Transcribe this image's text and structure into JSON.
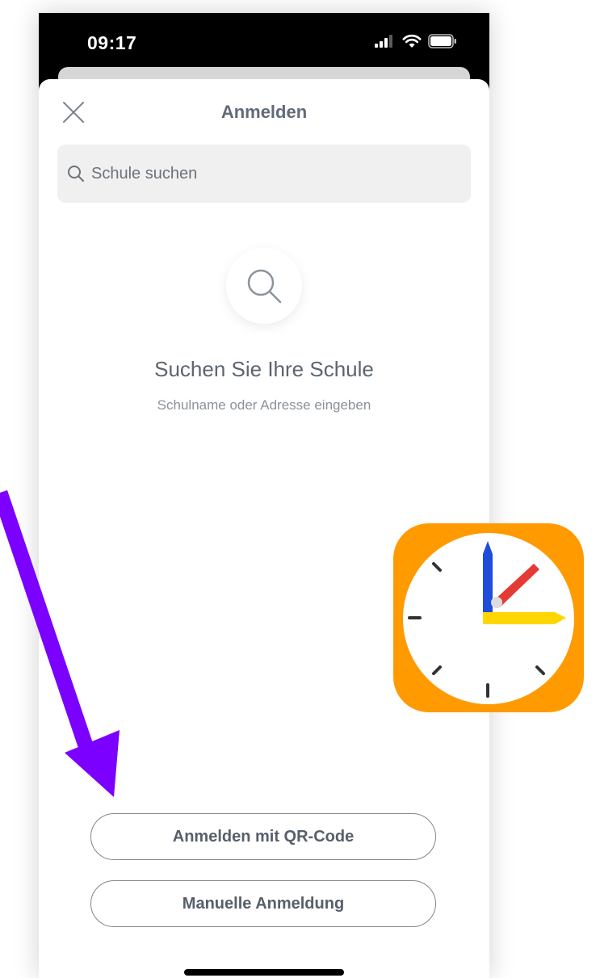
{
  "status_bar": {
    "time": "09:17"
  },
  "sheet": {
    "title": "Anmelden",
    "close_icon": "close-icon"
  },
  "search": {
    "placeholder": "Schule suchen",
    "icon": "search-icon"
  },
  "empty_state": {
    "icon": "magnifier-icon",
    "title": "Suchen Sie Ihre Schule",
    "subtitle": "Schulname oder Adresse eingeben"
  },
  "actions": {
    "qr_login_label": "Anmelden mit QR-Code",
    "manual_login_label": "Manuelle Anmeldung"
  },
  "overlay": {
    "arrow_color": "#7B00FF",
    "app_icon": "clock-app-icon",
    "app_icon_background": "#FF9A00"
  },
  "colors": {
    "text_primary": "#5B6570",
    "text_secondary": "#8A9299",
    "search_background": "#F0F0F0",
    "button_border": "#7E868D"
  }
}
